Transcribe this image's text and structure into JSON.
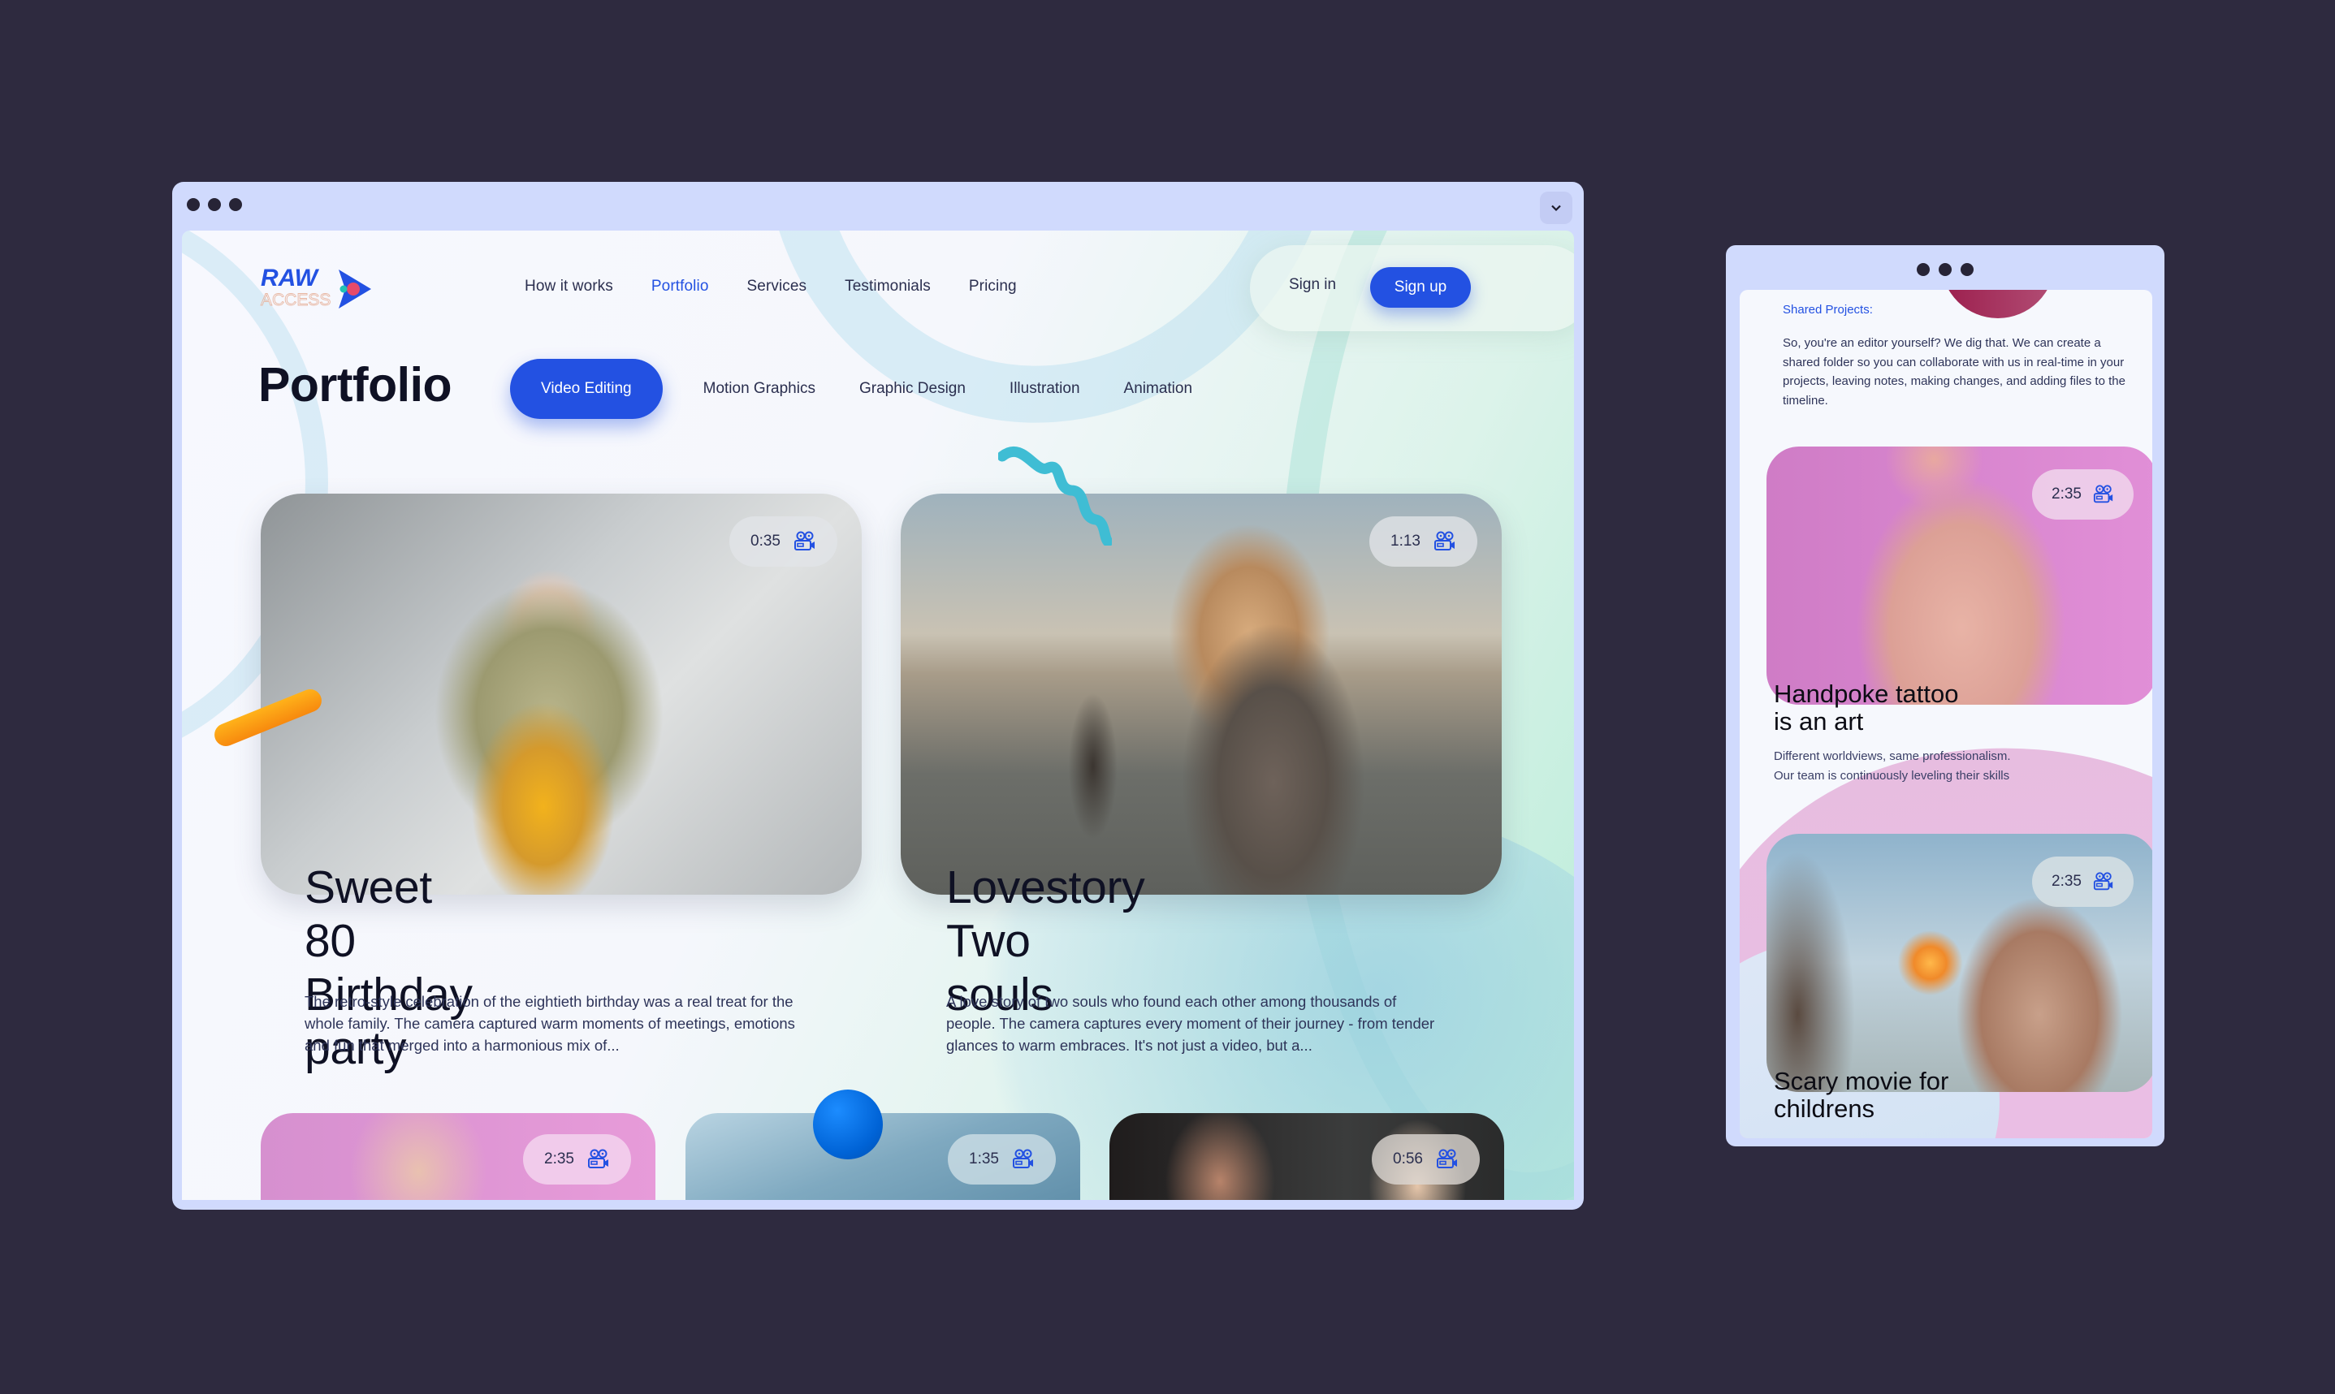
{
  "desktop": {
    "window_controls": {
      "collapse_icon": "chevron-down-icon"
    },
    "brand": {
      "logo_line1": "RAW",
      "logo_line2": "ACCESS",
      "logo_icon": "play-icon"
    },
    "nav": [
      {
        "label": "How it works",
        "active": false
      },
      {
        "label": "Portfolio",
        "active": true
      },
      {
        "label": "Services",
        "active": false
      },
      {
        "label": "Testimonials",
        "active": false
      },
      {
        "label": "Pricing",
        "active": false
      }
    ],
    "auth": {
      "sign_in": "Sign in",
      "sign_up": "Sign up"
    },
    "page_title": "Portfolio",
    "tabs": [
      {
        "label": "Video Editing",
        "active": true
      },
      {
        "label": "Motion Graphics",
        "active": false
      },
      {
        "label": "Graphic Design",
        "active": false
      },
      {
        "label": "Illustration",
        "active": false
      },
      {
        "label": "Animation",
        "active": false
      }
    ],
    "cards": [
      {
        "duration": "0:35",
        "duration_icon": "movie-camera-icon",
        "title": "Sweet 80\nBirthday party",
        "description": "The retro-style celebration of the eightieth birthday was a real treat for the whole family. The camera captured warm moments of meetings, emotions and fun that merged into a harmonious mix of..."
      },
      {
        "duration": "1:13",
        "duration_icon": "movie-camera-icon",
        "title": "Lovestory\nTwo souls",
        "description": "A love story of two souls who found each other among thousands of people. The camera captures every moment of their journey - from tender glances to warm embraces. It's not just a video, but a..."
      }
    ],
    "more_cards": [
      {
        "duration": "2:35",
        "duration_icon": "movie-camera-icon"
      },
      {
        "duration": "1:35",
        "duration_icon": "movie-camera-icon"
      },
      {
        "duration": "0:56",
        "duration_icon": "movie-camera-icon"
      }
    ],
    "colors": {
      "accent": "#2351e2",
      "frame": "#d0dafd",
      "backdrop": "#2e2a3f"
    }
  },
  "mobile": {
    "section_label": "Shared Projects:",
    "section_text": "So, you're an editor yourself? We dig that. We can create a shared folder so you can collaborate with us in real-time in your projects, leaving notes, making changes, and adding files to the timeline.",
    "cards": [
      {
        "duration": "2:35",
        "duration_icon": "movie-camera-icon",
        "title": "Handpoke tattoo\nis an art",
        "description": "Different worldviews, same professionalism.\nOur team is continuously leveling their skills"
      },
      {
        "duration": "2:35",
        "duration_icon": "movie-camera-icon",
        "title": "Scary movie for\nchildrens"
      }
    ]
  }
}
